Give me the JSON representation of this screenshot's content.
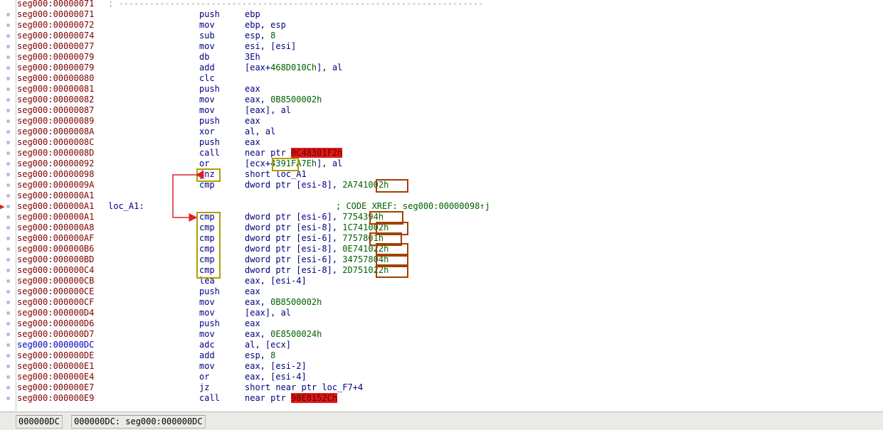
{
  "separator": "; -----------------------------------------------------------------------",
  "separator_addr": "seg000:00000071",
  "lines": [
    {
      "addr": "seg000:00000071",
      "mn": "push",
      "ops": "ebp"
    },
    {
      "addr": "seg000:00000072",
      "mn": "mov",
      "ops": "ebp, esp"
    },
    {
      "addr": "seg000:00000074",
      "mn": "sub",
      "ops": "esp, 8"
    },
    {
      "addr": "seg000:00000077",
      "mn": "mov",
      "ops": "esi, [esi]"
    },
    {
      "addr": "seg000:00000079",
      "mn": "db",
      "ops": "3Eh"
    },
    {
      "addr": "seg000:00000079",
      "mn": "add",
      "ops": "[eax+468D010Ch], al"
    },
    {
      "addr": "seg000:00000080",
      "mn": "clc",
      "ops": ""
    },
    {
      "addr": "seg000:00000081",
      "mn": "push",
      "ops": "eax"
    },
    {
      "addr": "seg000:00000082",
      "mn": "mov",
      "ops": "eax, 0B8500002h"
    },
    {
      "addr": "seg000:00000087",
      "mn": "mov",
      "ops": "[eax], al"
    },
    {
      "addr": "seg000:00000089",
      "mn": "push",
      "ops": "eax"
    },
    {
      "addr": "seg000:0000008A",
      "mn": "xor",
      "ops": "al, al"
    },
    {
      "addr": "seg000:0000008C",
      "mn": "push",
      "ops": "eax"
    },
    {
      "addr": "seg000:0000008D",
      "mn": "call",
      "ops": "near ptr 0C48301F2h"
    },
    {
      "addr": "seg000:00000092",
      "mn": "or",
      "ops": "[ecx+4391FA7Eh], al"
    },
    {
      "addr": "seg000:00000098",
      "mn": "jnz",
      "ops": "short loc_A1"
    },
    {
      "addr": "seg000:0000009A",
      "mn": "cmp",
      "ops": "dword ptr [esi-8], 2A741002h"
    },
    {
      "addr": "seg000:000000A1",
      "mn": "",
      "ops": ""
    },
    {
      "addr": "seg000:000000A1",
      "label": "loc_A1:",
      "mn": "",
      "ops": "",
      "comment": "; CODE XREF: seg000:00000098↑j"
    },
    {
      "addr": "seg000:000000A1",
      "mn": "cmp",
      "ops": "dword ptr [esi-6], 7754394h"
    },
    {
      "addr": "seg000:000000A8",
      "mn": "cmp",
      "ops": "dword ptr [esi-8], 1C741002h"
    },
    {
      "addr": "seg000:000000AF",
      "mn": "cmp",
      "ops": "dword ptr [esi-6], 7757801h"
    },
    {
      "addr": "seg000:000000B6",
      "mn": "cmp",
      "ops": "dword ptr [esi-8], 0E741022h"
    },
    {
      "addr": "seg000:000000BD",
      "mn": "cmp",
      "ops": "dword ptr [esi-6], 34757804h"
    },
    {
      "addr": "seg000:000000C4",
      "mn": "cmp",
      "ops": "dword ptr [esi-8], 2D751022h"
    },
    {
      "addr": "seg000:000000CB",
      "mn": "lea",
      "ops": "eax, [esi-4]"
    },
    {
      "addr": "seg000:000000CE",
      "mn": "push",
      "ops": "eax"
    },
    {
      "addr": "seg000:000000CF",
      "mn": "mov",
      "ops": "eax, 0B8500002h"
    },
    {
      "addr": "seg000:000000D4",
      "mn": "mov",
      "ops": "[eax], al"
    },
    {
      "addr": "seg000:000000D6",
      "mn": "push",
      "ops": "eax"
    },
    {
      "addr": "seg000:000000D7",
      "mn": "mov",
      "ops": "eax, 0E8500024h"
    },
    {
      "addr": "seg000:000000DC",
      "mn": "adc",
      "ops": "al, [ecx]"
    },
    {
      "addr": "seg000:000000DE",
      "mn": "add",
      "ops": "esp, 8"
    },
    {
      "addr": "seg000:000000E1",
      "mn": "mov",
      "ops": "eax, [esi-2]"
    },
    {
      "addr": "seg000:000000E4",
      "mn": "or",
      "ops": "eax, [esi-4]"
    },
    {
      "addr": "seg000:000000E7",
      "mn": "jz",
      "ops": "short near ptr loc_F7+4"
    },
    {
      "addr": "seg000:000000E9",
      "mn": "call",
      "ops": "near ptr 98E8152Ch"
    }
  ],
  "status": {
    "offset": "000000DC",
    "location": "000000DC: seg000:000000DC"
  },
  "colors": {
    "address": "#800000",
    "current_address": "#0000c0",
    "mnemonic": "#000080",
    "number": "#006000",
    "bad_target_bg": "#e01818",
    "annotation_olive": "#b0a000",
    "annotation_brown": "#a04000",
    "arrow": "#e02020"
  }
}
